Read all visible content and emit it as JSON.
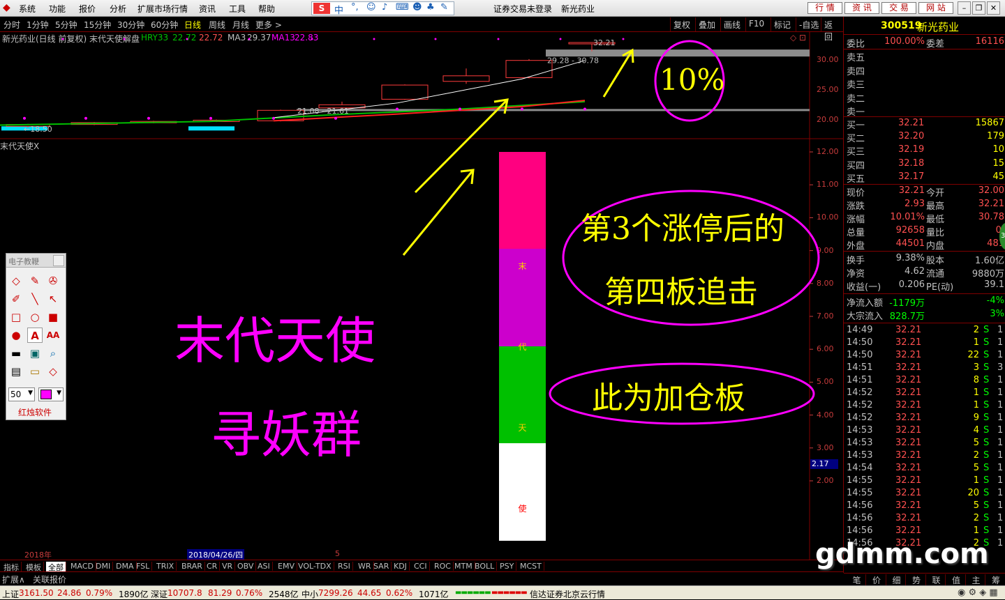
{
  "menu": {
    "items": [
      "系统",
      "功能",
      "报价",
      "分析",
      "扩展市场行情",
      "资讯",
      "工具",
      "帮助"
    ],
    "ime_label": "中",
    "login_status": "证券交易未登录",
    "stock_name": "新光药业",
    "right_buttons": [
      "行 情",
      "资 讯",
      "交 易",
      "网 站"
    ]
  },
  "periods": {
    "items": [
      "分时",
      "1分钟",
      "5分钟",
      "15分钟",
      "30分钟",
      "60分钟",
      "日线",
      "周线",
      "月线",
      "更多 >"
    ],
    "active": "日线",
    "tools": [
      "复权",
      "叠加",
      "画线",
      "F10",
      "标记",
      "-自选",
      "返回"
    ]
  },
  "chart_data": {
    "type": "candlestick",
    "title": "新光药业(日线 前复权) 末代天使解盘",
    "indicators": [
      {
        "name": "HRY33",
        "value": "22.72",
        "color": "#00c000"
      },
      {
        "name": "",
        "value": "22.72",
        "color": "#ff5050"
      },
      {
        "name": "MA3",
        "value": "29.37",
        "color": "#c0c0c0"
      },
      {
        "name": "MA13",
        "value": "22.83",
        "color": "#ff00ff"
      }
    ],
    "ylim": [
      17.5,
      33
    ],
    "yticks": [
      "30.00",
      "25.00",
      "20.00"
    ],
    "annotations": [
      "←18.50",
      "21.08 - 21.61",
      "29.28 - 30.78",
      "32.21"
    ],
    "candles": [
      {
        "open": 18.6,
        "close": 18.9,
        "high": 19.0,
        "low": 18.4
      },
      {
        "open": 18.9,
        "close": 19.2,
        "high": 19.3,
        "low": 18.8
      },
      {
        "open": 19.2,
        "close": 19.4,
        "high": 19.5,
        "low": 19.1
      },
      {
        "open": 19.4,
        "close": 19.6,
        "high": 19.7,
        "low": 19.3
      },
      {
        "open": 19.5,
        "close": 21.2,
        "high": 21.3,
        "low": 19.4
      },
      {
        "open": 21.6,
        "close": 22.1,
        "high": 22.6,
        "low": 21.5
      },
      {
        "open": 23.0,
        "close": 25.3,
        "high": 25.4,
        "low": 22.9
      },
      {
        "open": 25.9,
        "close": 26.8,
        "high": 28.0,
        "low": 25.5
      },
      {
        "open": 26.5,
        "close": 29.3,
        "high": 29.5,
        "low": 26.4
      },
      {
        "open": 32.0,
        "close": 32.21,
        "high": 32.21,
        "low": 30.78
      }
    ],
    "lower_pane": {
      "title": "末代天使X",
      "yticks": [
        "12.00",
        "11.00",
        "10.00",
        "9.00",
        "8.00",
        "7.00",
        "6.00",
        "5.00",
        "4.00",
        "3.00",
        "2.00"
      ],
      "ylim": [
        1.0,
        12.5
      ],
      "current_value": "2.17",
      "bar_segments": [
        {
          "label": "",
          "color": "#ff0080"
        },
        {
          "label": "末",
          "color": "#cc00cc"
        },
        {
          "label": "代",
          "color": "#00c000"
        },
        {
          "label": "天",
          "color": "#00c000"
        },
        {
          "label": "使",
          "color": "#ffffff"
        }
      ]
    },
    "x_labels": [
      "2018年",
      "2018/04/26/四",
      "5"
    ]
  },
  "overlays": {
    "pct": "10%",
    "chase": [
      "第3个涨停后的",
      "第四板追击"
    ],
    "add": "此为加仓板",
    "brand1": "末代天使",
    "brand2": "寻妖群"
  },
  "toolbox": {
    "title": "电子教鞭",
    "size": "50",
    "footer": "红烛软件"
  },
  "quote": {
    "code": "300519",
    "name": "新光药业",
    "weibi_label": "委比",
    "weibi": "100.00%",
    "weicha_label": "委差",
    "weicha": "16116",
    "sell": [
      {
        "label": "卖五"
      },
      {
        "label": "卖四"
      },
      {
        "label": "卖三"
      },
      {
        "label": "卖二"
      },
      {
        "label": "卖一"
      }
    ],
    "buy": [
      {
        "label": "买一",
        "price": "32.21",
        "vol": "15867"
      },
      {
        "label": "买二",
        "price": "32.20",
        "vol": "179"
      },
      {
        "label": "买三",
        "price": "32.19",
        "vol": "10"
      },
      {
        "label": "买四",
        "price": "32.18",
        "vol": "15"
      },
      {
        "label": "买五",
        "price": "32.17",
        "vol": "45"
      }
    ],
    "stats": [
      {
        "a": "现价",
        "b": "32.21",
        "c": "今开",
        "d": "32.00"
      },
      {
        "a": "涨跌",
        "b": "2.93",
        "c": "最高",
        "d": "32.21"
      },
      {
        "a": "涨幅",
        "b": "10.01%",
        "c": "最低",
        "d": "30.78"
      },
      {
        "a": "总量",
        "b": "92658",
        "c": "量比",
        "d": "0."
      },
      {
        "a": "外盘",
        "b": "44501",
        "c": "内盘",
        "d": "481"
      }
    ],
    "stats2": [
      {
        "a": "换手",
        "b": "9.38%",
        "c": "股本",
        "d": "1.60亿"
      },
      {
        "a": "净资",
        "b": "4.62",
        "c": "流通",
        "d": "9880万"
      },
      {
        "a": "收益(一)",
        "b": "0.206",
        "c": "PE(动)",
        "d": "39.1"
      }
    ],
    "flow": [
      {
        "a": "净流入额",
        "b": "-1179万",
        "d": "-4%"
      },
      {
        "a": "大宗流入",
        "b": "828.7万",
        "d": "3%"
      }
    ],
    "trades": [
      {
        "t": "14:49",
        "p": "32.21",
        "v": "2",
        "s": "S",
        "n": "1"
      },
      {
        "t": "14:50",
        "p": "32.21",
        "v": "1",
        "s": "S",
        "n": "1"
      },
      {
        "t": "14:50",
        "p": "32.21",
        "v": "22",
        "s": "S",
        "n": "1"
      },
      {
        "t": "14:51",
        "p": "32.21",
        "v": "3",
        "s": "S",
        "n": "3"
      },
      {
        "t": "14:51",
        "p": "32.21",
        "v": "8",
        "s": "S",
        "n": "1"
      },
      {
        "t": "14:52",
        "p": "32.21",
        "v": "1",
        "s": "S",
        "n": "1"
      },
      {
        "t": "14:52",
        "p": "32.21",
        "v": "1",
        "s": "S",
        "n": "1"
      },
      {
        "t": "14:52",
        "p": "32.21",
        "v": "9",
        "s": "S",
        "n": "1"
      },
      {
        "t": "14:53",
        "p": "32.21",
        "v": "4",
        "s": "S",
        "n": "1"
      },
      {
        "t": "14:53",
        "p": "32.21",
        "v": "5",
        "s": "S",
        "n": "1"
      },
      {
        "t": "14:53",
        "p": "32.21",
        "v": "2",
        "s": "S",
        "n": "1"
      },
      {
        "t": "14:54",
        "p": "32.21",
        "v": "5",
        "s": "S",
        "n": "1"
      },
      {
        "t": "14:55",
        "p": "32.21",
        "v": "1",
        "s": "S",
        "n": "1"
      },
      {
        "t": "14:55",
        "p": "32.21",
        "v": "20",
        "s": "S",
        "n": "1"
      },
      {
        "t": "14:56",
        "p": "32.21",
        "v": "5",
        "s": "S",
        "n": "1"
      },
      {
        "t": "14:56",
        "p": "32.21",
        "v": "2",
        "s": "S",
        "n": "1"
      },
      {
        "t": "14:56",
        "p": "32.21",
        "v": "1",
        "s": "S",
        "n": "1"
      },
      {
        "t": "14:56",
        "p": "32.21",
        "v": "2",
        "s": "S",
        "n": "1"
      }
    ],
    "bottom_tabs": [
      "笔",
      "价",
      "细",
      "势",
      "联",
      "值",
      "主",
      "筹"
    ]
  },
  "indicator_tabs": [
    "指标",
    "模板",
    "全部",
    "MACD",
    "DMI",
    "DMA",
    "FSL",
    "TRIX",
    "BRAR",
    "CR",
    "VR",
    "OBV",
    "ASI",
    "EMV",
    "VOL-TDX",
    "RSI",
    "WR",
    "SAR",
    "KDJ",
    "CCI",
    "ROC",
    "MTM",
    "BOLL",
    "PSY",
    "MCST"
  ],
  "indicator_active": "全部",
  "ext_tabs": [
    "扩展∧",
    "关联报价"
  ],
  "statusbar": {
    "sh_label": "上证",
    "sh": "3161.50",
    "sh_chg": "24.86",
    "sh_pct": "0.79%",
    "sh_amt": "1890亿",
    "sz_label": "深证",
    "sz": "10707.8",
    "sz_chg": "81.29",
    "sz_pct": "0.76%",
    "sz_amt": "2548亿",
    "zx_label": "中小",
    "zx": "7299.26",
    "zx_chg": "44.65",
    "zx_pct": "0.62%",
    "zx_amt": "1071亿",
    "server": "信达证券北京云行情"
  },
  "watermark": "gdmm.com"
}
